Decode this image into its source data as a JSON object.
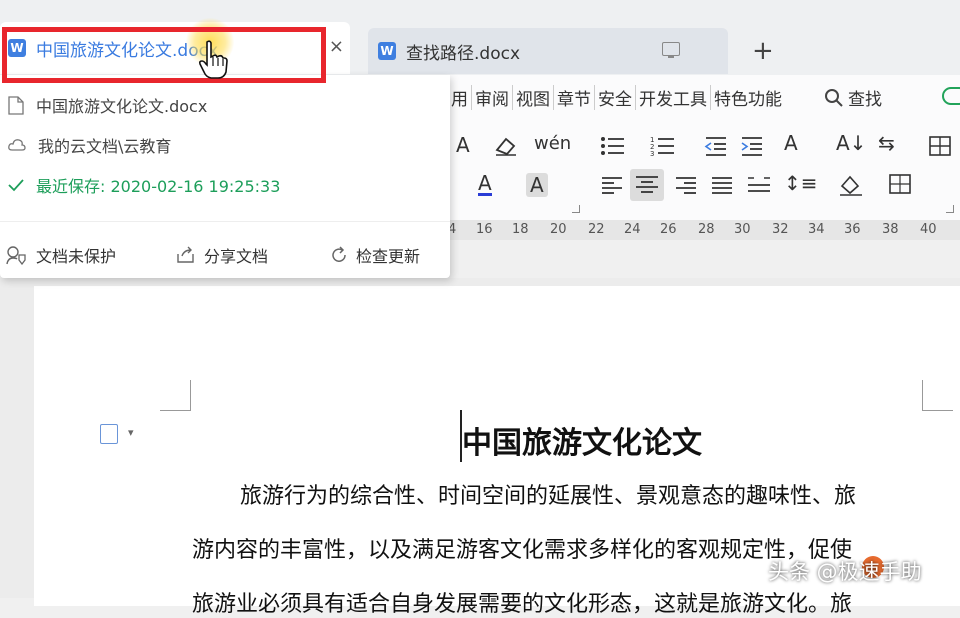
{
  "tabs": [
    {
      "label": "中国旅游文化论文.docx",
      "icon_letter": "W",
      "close": "×"
    },
    {
      "label": "查找路径.docx",
      "icon_letter": "W"
    }
  ],
  "add_tab": "+",
  "menus": [
    "用",
    "审阅",
    "视图",
    "章节",
    "安全",
    "开发工具",
    "特色功能"
  ],
  "search_label": "查找",
  "dropdown": {
    "file_name": "中国旅游文化论文.docx",
    "cloud_path": "我的云文档\\云教育",
    "save_status": "最近保存: 2020-02-16 19:25:33",
    "actions": [
      "文档未保护",
      "分享文档",
      "检查更新"
    ]
  },
  "ruler_marks": [
    "4",
    "16",
    "18",
    "20",
    "22",
    "24",
    "26",
    "28",
    "30",
    "32",
    "34",
    "36",
    "38",
    "40"
  ],
  "document": {
    "title": "中国旅游文化论文",
    "lines": [
      "旅游行为的综合性、时间空间的延展性、景观意态的趣味性、旅",
      "游内容的丰富性，以及满足游客文化需求多样化的客观规定性，促使",
      "旅游业必须具有适合自身发展需要的文化形态，这就是旅游文化。旅"
    ]
  },
  "watermark": "头条 @极速手助",
  "colors": {
    "accent_blue": "#3a7be0",
    "highlight_red": "#e8262d",
    "save_green": "#1d9e5a"
  }
}
